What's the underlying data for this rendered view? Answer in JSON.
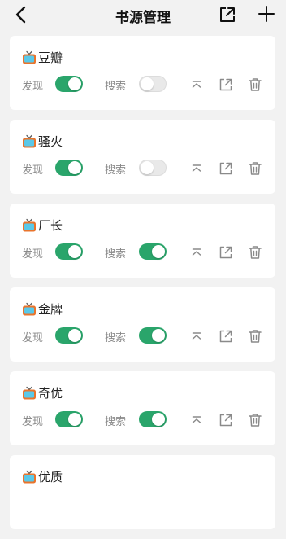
{
  "header": {
    "title": "书源管理",
    "icons": [
      "back-arrow-icon",
      "export-icon",
      "plus-icon"
    ]
  },
  "labels": {
    "discover": "发现",
    "search": "搜索"
  },
  "colors": {
    "toggle_on": "#2aa56b",
    "toggle_off": "#e9e9e9",
    "icon_gray": "#8a8a8a"
  },
  "sources": [
    {
      "name": "豆瓣",
      "discover": true,
      "search": false
    },
    {
      "name": "骚火",
      "discover": true,
      "search": false
    },
    {
      "name": "厂长",
      "discover": true,
      "search": true
    },
    {
      "name": "金牌",
      "discover": true,
      "search": true
    },
    {
      "name": "奇优",
      "discover": true,
      "search": true
    },
    {
      "name": "优质"
    }
  ],
  "item_icons": [
    "tv-icon",
    "move-to-top-icon",
    "export-icon",
    "trash-icon"
  ]
}
